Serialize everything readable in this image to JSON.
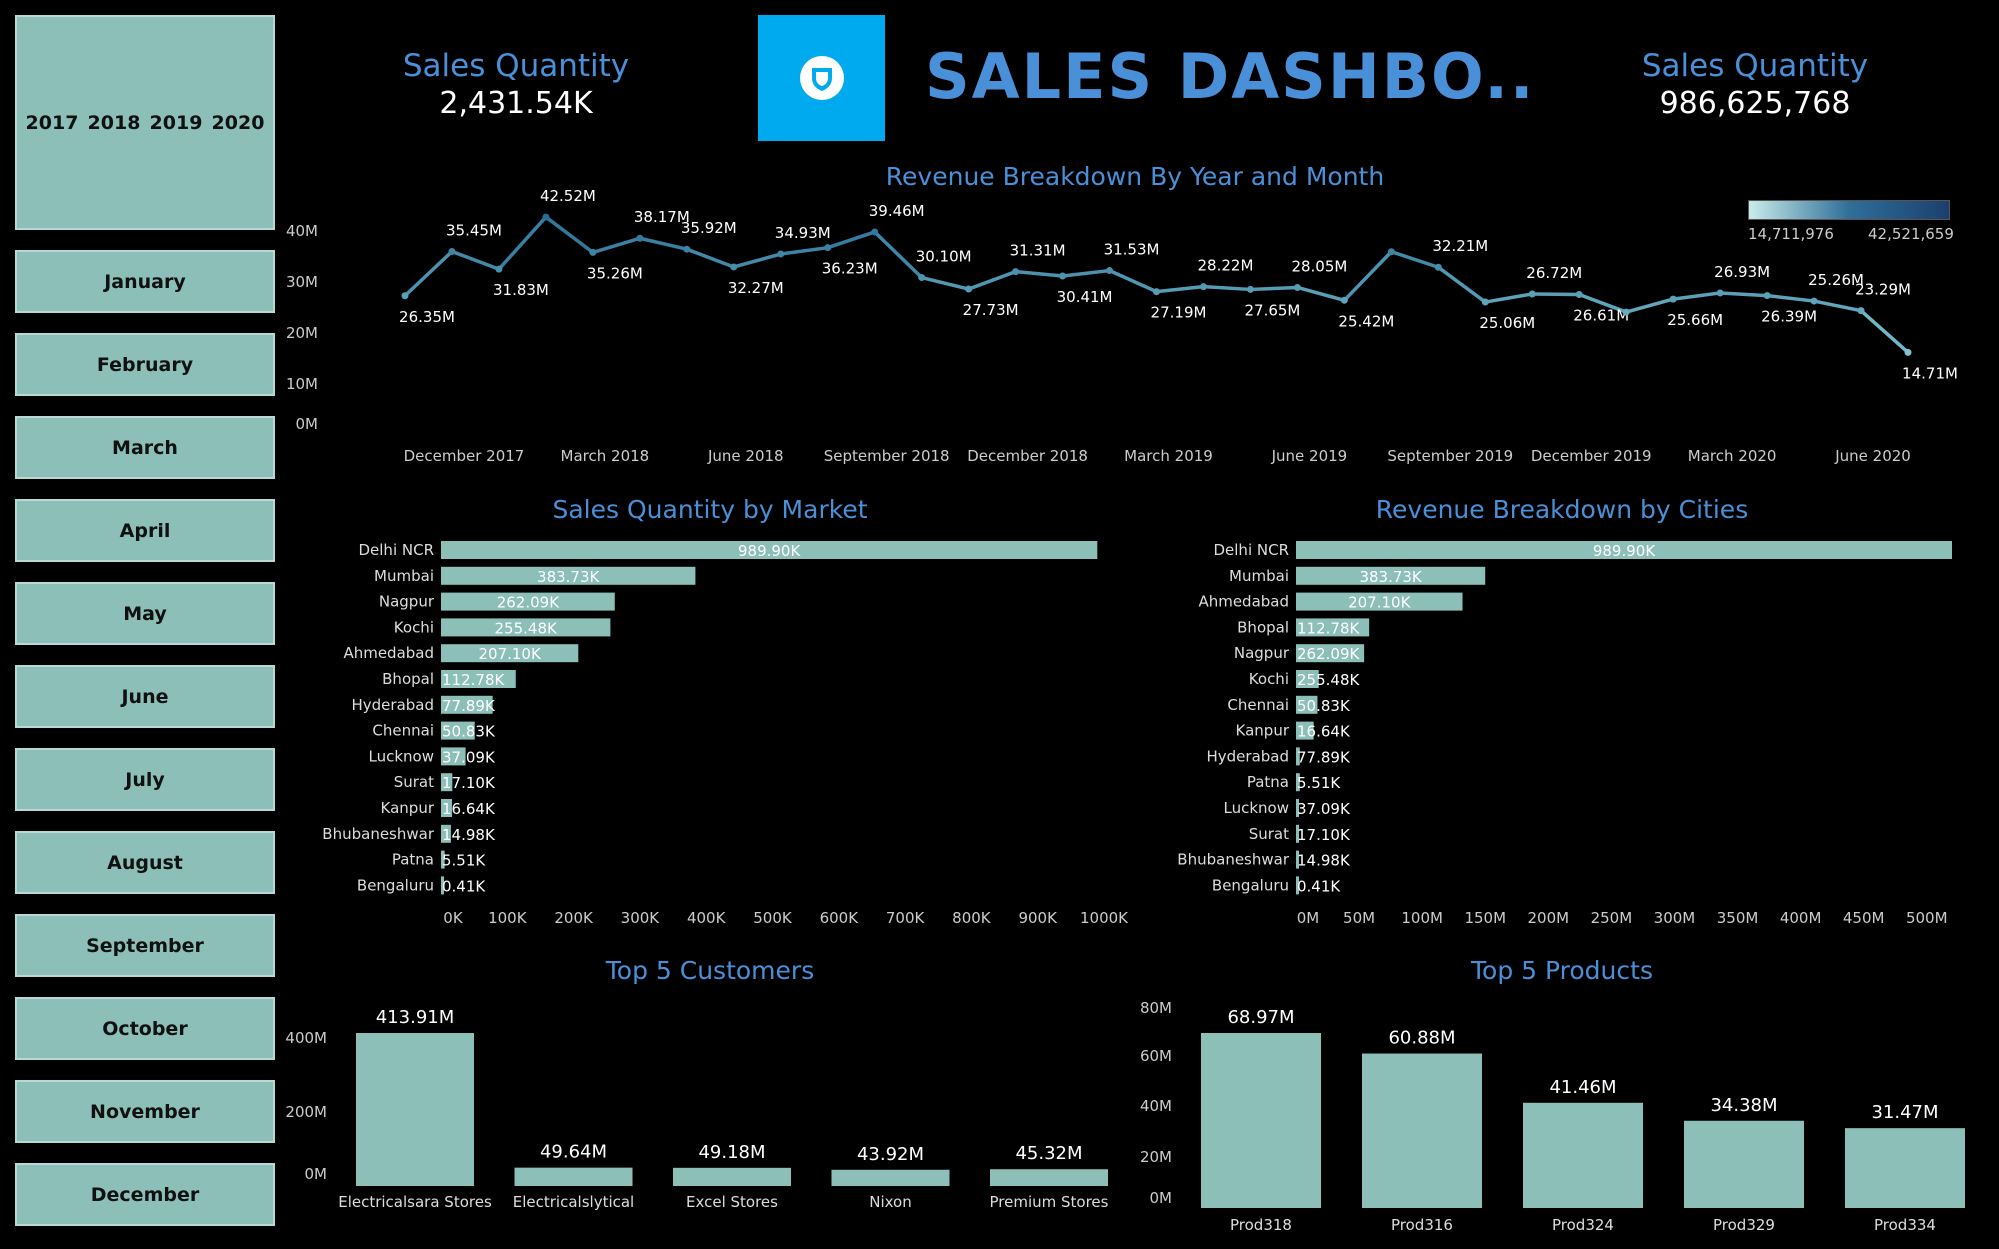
{
  "sidebar": {
    "years": [
      "2017",
      "2018",
      "2019",
      "2020"
    ],
    "months": [
      "January",
      "February",
      "March",
      "April",
      "May",
      "June",
      "July",
      "August",
      "September",
      "October",
      "November",
      "December"
    ]
  },
  "header": {
    "kpi_left_label": "Sales Quantity",
    "kpi_left_value": "2,431.54K",
    "title": "SALES DASHBO..",
    "kpi_right_label": "Sales Quantity",
    "kpi_right_value": "986,625,768"
  },
  "colors": {
    "bar": "#8cbfb8",
    "title": "#4a90d9",
    "line_light": "#7fc4cf",
    "line_dark": "#2f6f99"
  },
  "chart_data": [
    {
      "id": "line",
      "type": "line",
      "title": "Revenue Breakdown By Year and Month",
      "legend": {
        "min": "14,711,976",
        "max": "42,521,659"
      },
      "ylim": [
        0,
        45
      ],
      "yticks": [
        0,
        10,
        20,
        30,
        40
      ],
      "ytick_labels": [
        "0M",
        "10M",
        "20M",
        "30M",
        "40M"
      ],
      "xtick_labels": [
        "December 2017",
        "March 2018",
        "June 2018",
        "September 2018",
        "December 2018",
        "March 2019",
        "June 2019",
        "September 2019",
        "December 2019",
        "March 2020",
        "June 2020"
      ],
      "xtick_index": [
        1,
        4,
        7,
        10,
        13,
        16,
        19,
        22,
        25,
        28,
        31
      ],
      "values": [
        26.35,
        35.45,
        31.83,
        42.52,
        35.26,
        38.17,
        35.92,
        32.27,
        34.93,
        36.23,
        39.46,
        30.1,
        27.73,
        31.31,
        30.41,
        31.53,
        27.19,
        28.22,
        27.65,
        28.05,
        25.42,
        35.4,
        32.21,
        25.06,
        26.72,
        26.61,
        23.0,
        25.66,
        26.93,
        26.39,
        25.26,
        23.29,
        14.71
      ],
      "labels": [
        "26.35M",
        "35.45M",
        "31.83M",
        "42.52M",
        "35.26M",
        "38.17M",
        "35.92M",
        "32.27M",
        "34.93M",
        "36.23M",
        "39.46M",
        "30.10M",
        "27.73M",
        "31.31M",
        "30.41M",
        "31.53M",
        "27.19M",
        "28.22M",
        "27.65M",
        "28.05M",
        "25.42M",
        "",
        "32.21M",
        "25.06M",
        "26.72M",
        "26.61M",
        "",
        "25.66M",
        "26.93M",
        "26.39M",
        "25.26M",
        "23.29M",
        "14.71M"
      ],
      "label_pos": [
        "b",
        "a",
        "b",
        "a",
        "b",
        "a",
        "a",
        "b",
        "a",
        "b",
        "a",
        "a",
        "b",
        "a",
        "b",
        "a",
        "b",
        "a",
        "b",
        "a",
        "b",
        "a",
        "a",
        "b",
        "a",
        "b",
        "a",
        "b",
        "a",
        "b",
        "a",
        "a",
        "b"
      ]
    },
    {
      "id": "market",
      "type": "bar",
      "orientation": "horizontal",
      "title": "Sales Quantity by Market",
      "categories": [
        "Delhi NCR",
        "Mumbai",
        "Nagpur",
        "Kochi",
        "Ahmedabad",
        "Bhopal",
        "Hyderabad",
        "Chennai",
        "Lucknow",
        "Surat",
        "Kanpur",
        "Bhubaneshwar",
        "Patna",
        "Bengaluru"
      ],
      "values": [
        989.9,
        383.73,
        262.09,
        255.48,
        207.1,
        112.78,
        77.89,
        50.83,
        37.09,
        17.1,
        16.64,
        14.98,
        5.51,
        0.41
      ],
      "labels": [
        "989.90K",
        "383.73K",
        "262.09K",
        "255.48K",
        "207.10K",
        "112.78K",
        "77.89K",
        "50.83K",
        "37.09K",
        "17.10K",
        "16.64K",
        "14.98K",
        "5.51K",
        "0.41K"
      ],
      "xlim": [
        0,
        1000
      ],
      "xticks": [
        0,
        100,
        200,
        300,
        400,
        500,
        600,
        700,
        800,
        900,
        1000
      ],
      "xtick_labels": [
        "0K",
        "100K",
        "200K",
        "300K",
        "400K",
        "500K",
        "600K",
        "700K",
        "800K",
        "900K",
        "1000K"
      ]
    },
    {
      "id": "cities",
      "type": "bar",
      "orientation": "horizontal",
      "title": "Revenue Breakdown by Cities",
      "categories": [
        "Delhi NCR",
        "Mumbai",
        "Ahmedabad",
        "Bhopal",
        "Nagpur",
        "Kochi",
        "Chennai",
        "Kanpur",
        "Hyderabad",
        "Patna",
        "Lucknow",
        "Surat",
        "Bhubaneshwar",
        "Bengaluru"
      ],
      "values": [
        520,
        150,
        132,
        58,
        54,
        18,
        17,
        14,
        3,
        3,
        2,
        2,
        1.5,
        0.5
      ],
      "labels": [
        "989.90K",
        "383.73K",
        "207.10K",
        "112.78K",
        "262.09K",
        "255.48K",
        "50.83K",
        "16.64K",
        "77.89K",
        "5.51K",
        "37.09K",
        "17.10K",
        "14.98K",
        "0.41K"
      ],
      "xlim": [
        0,
        520
      ],
      "xticks": [
        0,
        50,
        100,
        150,
        200,
        250,
        300,
        350,
        400,
        450,
        500
      ],
      "xtick_labels": [
        "0M",
        "50M",
        "100M",
        "150M",
        "200M",
        "250M",
        "300M",
        "350M",
        "400M",
        "450M",
        "500M"
      ]
    },
    {
      "id": "customers",
      "type": "bar",
      "title": "Top 5 Customers",
      "categories": [
        "Electricalsara Stores",
        "Electricalslytical",
        "Excel Stores",
        "Nixon",
        "Premium Stores"
      ],
      "values": [
        413.91,
        49.64,
        49.18,
        43.92,
        45.32
      ],
      "labels": [
        "413.91M",
        "49.64M",
        "49.18M",
        "43.92M",
        "45.32M"
      ],
      "ylim": [
        0,
        413.91
      ],
      "yticks": [
        0,
        200,
        400
      ],
      "ytick_labels": [
        "0M",
        "200M",
        "400M"
      ]
    },
    {
      "id": "products",
      "type": "bar",
      "title": "Top 5 Products",
      "categories": [
        "Prod318",
        "Prod316",
        "Prod324",
        "Prod329",
        "Prod334"
      ],
      "values": [
        68.97,
        60.88,
        41.46,
        34.38,
        31.47
      ],
      "labels": [
        "68.97M",
        "60.88M",
        "41.46M",
        "34.38M",
        "31.47M"
      ],
      "ylim": [
        0,
        68.97
      ],
      "yticks": [
        0,
        20,
        40,
        60,
        80
      ],
      "ytick_labels": [
        "0M",
        "20M",
        "40M",
        "60M",
        "80M"
      ]
    }
  ]
}
